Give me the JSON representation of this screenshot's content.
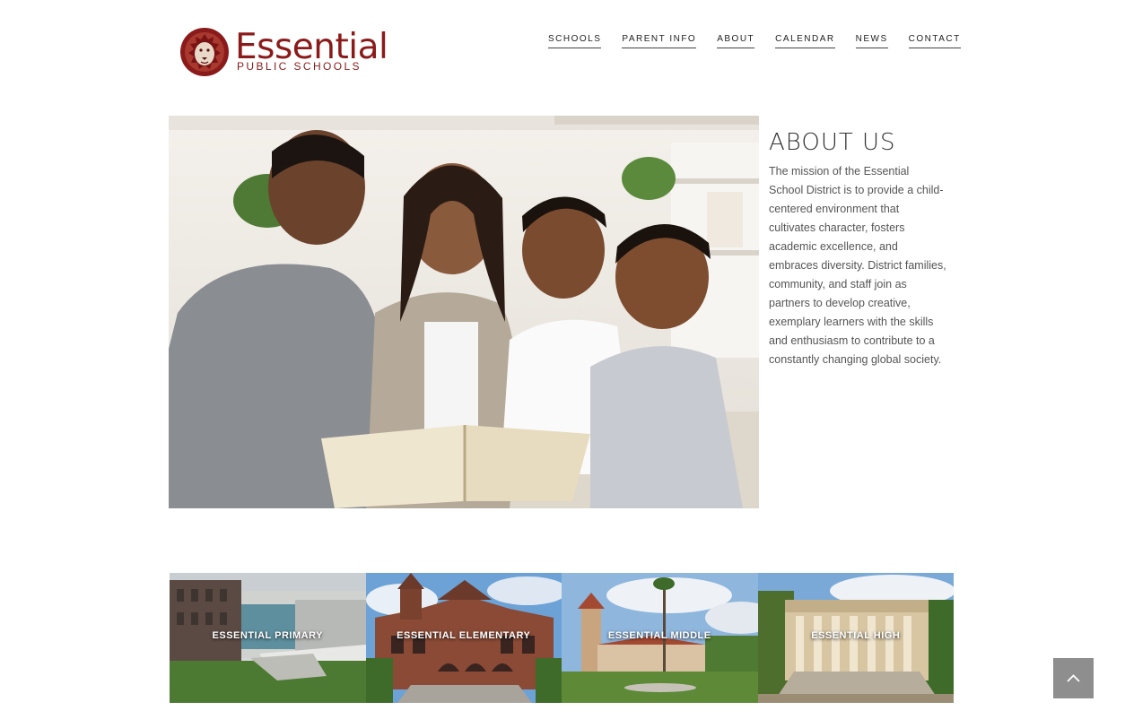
{
  "brand": {
    "name": "Essential",
    "subtitle": "PUBLIC SCHOOLS",
    "emblem_icon": "lion-head-icon",
    "color": "#8b1a1a"
  },
  "nav": {
    "items": [
      {
        "label": "SCHOOLS"
      },
      {
        "label": "PARENT INFO"
      },
      {
        "label": "ABOUT"
      },
      {
        "label": "CALENDAR"
      },
      {
        "label": "NEWS"
      },
      {
        "label": "CONTACT"
      }
    ]
  },
  "hero": {
    "image": "family-reading-book-photo"
  },
  "about": {
    "title": "ABOUT US",
    "text": "The mission of the Essential School District is to provide a child-centered environment that cultivates character, fosters academic excellence, and embraces diversity. District families, community, and staff join as partners to develop creative, exemplary learners with the skills and enthusiasm to contribute to a constantly changing global society."
  },
  "schools": [
    {
      "label": "ESSENTIAL PRIMARY",
      "image": "modern-school-building-photo"
    },
    {
      "label": "ESSENTIAL ELEMENTARY",
      "image": "red-brick-historic-building-photo"
    },
    {
      "label": "ESSENTIAL MIDDLE",
      "image": "mission-style-tower-photo"
    },
    {
      "label": "ESSENTIAL HIGH",
      "image": "columned-hall-photo"
    }
  ],
  "scroll_top": {
    "icon": "chevron-up-icon",
    "color": "#8e8e8e"
  }
}
